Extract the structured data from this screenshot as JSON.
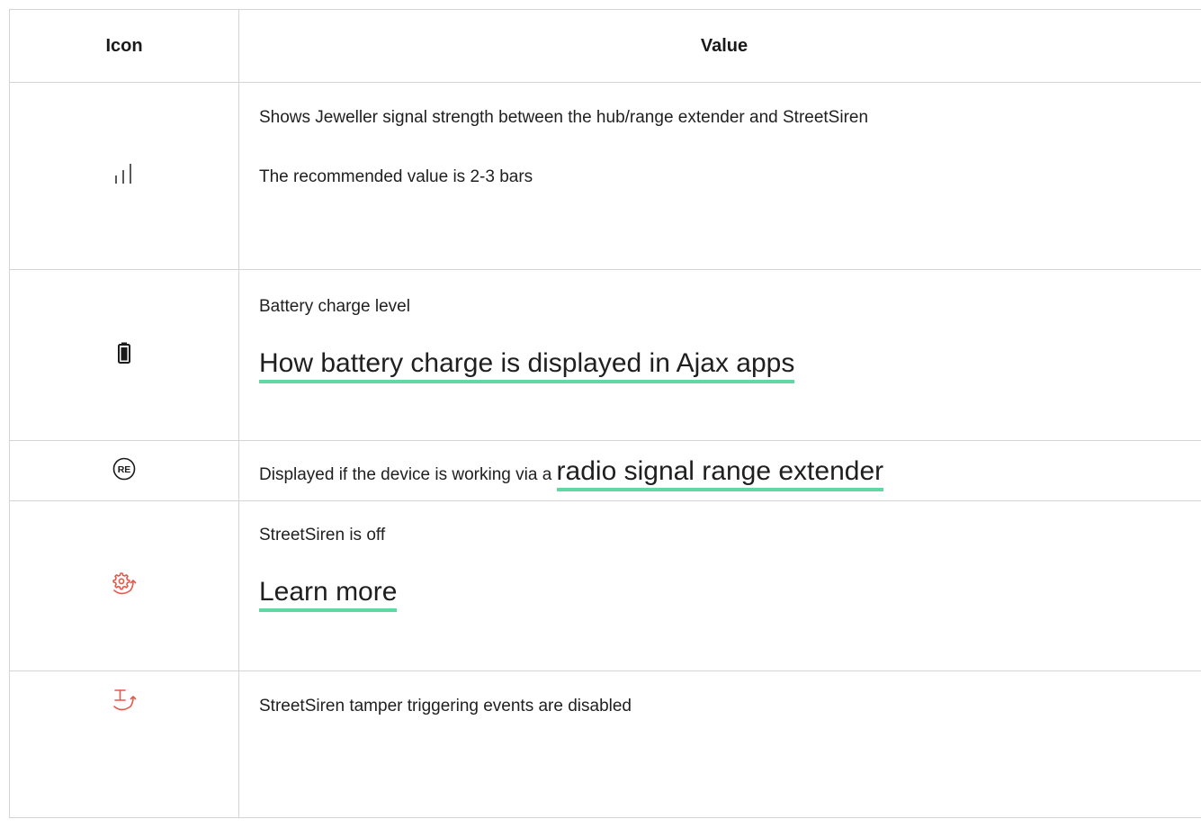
{
  "table": {
    "headers": {
      "icon": "Icon",
      "value": "Value"
    },
    "rows": [
      {
        "icon": "signal-strength-icon",
        "lines": [
          "Shows Jeweller signal strength between the hub/range extender and StreetSiren",
          "The recommended value is 2-3 bars"
        ]
      },
      {
        "icon": "battery-icon",
        "lines": [
          "Battery charge level"
        ],
        "link": "How battery charge is displayed in Ajax apps"
      },
      {
        "icon": "range-extender-icon",
        "icon_text": "RE",
        "text": "Displayed if the device is working via a",
        "link": "radio signal range extender"
      },
      {
        "icon": "device-off-icon",
        "icon_color": "#e8584a",
        "lines": [
          "StreetSiren is off"
        ],
        "link": "Learn more"
      },
      {
        "icon": "tamper-disabled-icon",
        "icon_color": "#e8584a",
        "lines": [
          "StreetSiren tamper triggering events are disabled"
        ]
      }
    ]
  },
  "colors": {
    "border": "#d4d4d4",
    "link_underline": "#5fd8a4",
    "alert_icon": "#e8584a",
    "text": "#1f1f1f"
  }
}
